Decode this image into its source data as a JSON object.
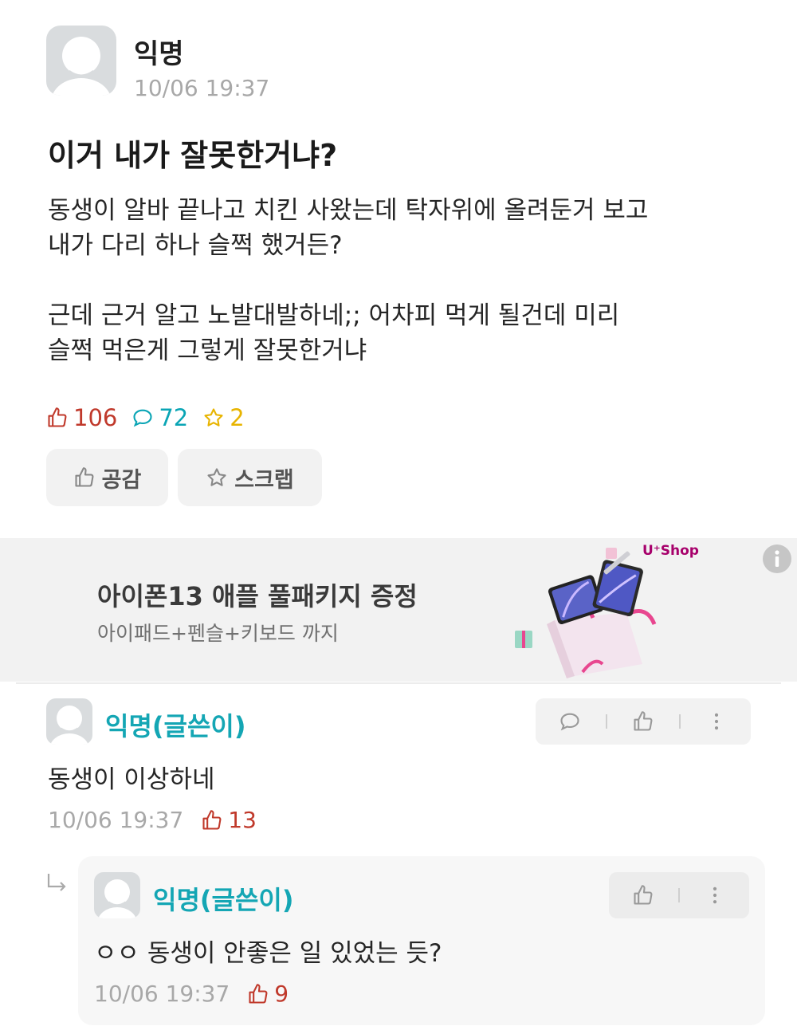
{
  "post": {
    "author": "익명",
    "time": "10/06 19:37",
    "title": "이거 내가 잘못한거냐?",
    "body_lines": [
      "동생이 알바 끝나고 치킨 사왔는데 탁자위에 올려둔거 보고",
      "내가 다리 하나 슬쩍 했거든?",
      "근데 근거 알고 노발대발하네;; 어차피 먹게 될건데 미리",
      "슬쩍 먹은게 그렇게 잘못한거냐"
    ],
    "stats": {
      "likes": "106",
      "comments": "72",
      "scraps": "2"
    },
    "actions": {
      "like_label": "공감",
      "scrap_label": "스크랩"
    }
  },
  "ad": {
    "title": "아이폰13 애플 풀패키지 증정",
    "subtitle": "아이패드+펜슬+키보드 까지",
    "brand": "U⁺Shop"
  },
  "comments": [
    {
      "author": "익명(글쓴이)",
      "text": "동생이 이상하네",
      "time": "10/06 19:37",
      "likes": "13"
    }
  ],
  "reply": {
    "author": "익명(글쓴이)",
    "text": "ㅇㅇ 동생이 안좋은 일 있었는 듯?",
    "time": "10/06 19:37",
    "likes": "9"
  },
  "colors": {
    "like_red": "#c0392b",
    "comment_teal": "#0aa5b5",
    "scrap_yellow": "#e8b400",
    "author_teal": "#14a6b4",
    "meta_gray": "#a8a8a8"
  },
  "icons": [
    "thumbs-up-icon",
    "speech-bubble-icon",
    "star-icon",
    "more-vertical-icon",
    "reply-arrow-icon",
    "info-icon"
  ]
}
